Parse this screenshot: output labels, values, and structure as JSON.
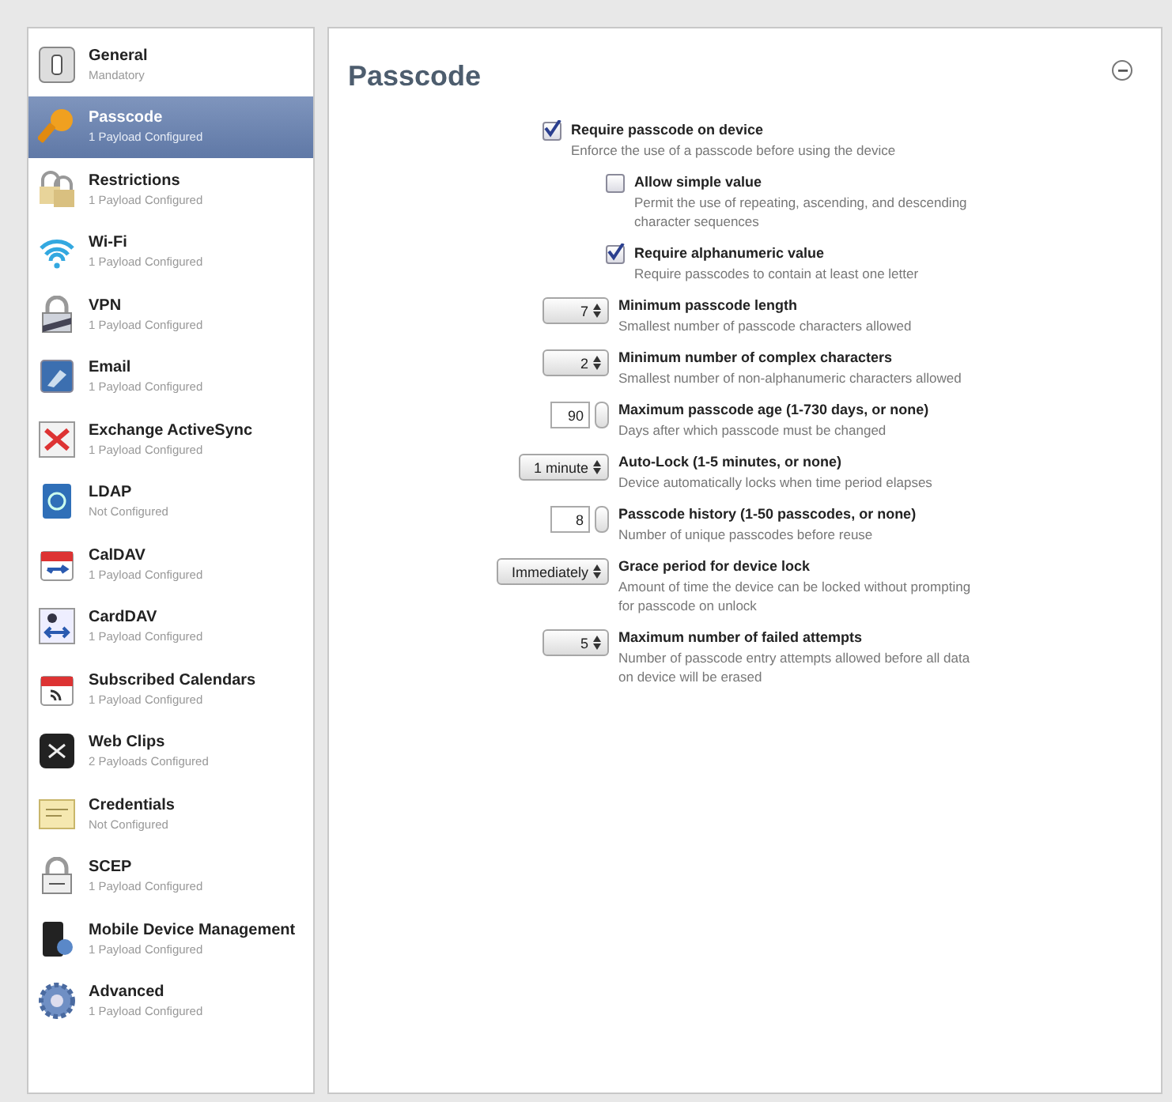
{
  "sidebar": {
    "items": [
      {
        "title": "General",
        "subtitle": "Mandatory",
        "selected": false
      },
      {
        "title": "Passcode",
        "subtitle": "1 Payload Configured",
        "selected": true
      },
      {
        "title": "Restrictions",
        "subtitle": "1 Payload Configured",
        "selected": false
      },
      {
        "title": "Wi-Fi",
        "subtitle": "1 Payload Configured",
        "selected": false
      },
      {
        "title": "VPN",
        "subtitle": "1 Payload Configured",
        "selected": false
      },
      {
        "title": "Email",
        "subtitle": "1 Payload Configured",
        "selected": false
      },
      {
        "title": "Exchange ActiveSync",
        "subtitle": "1 Payload Configured",
        "selected": false
      },
      {
        "title": "LDAP",
        "subtitle": "Not Configured",
        "selected": false
      },
      {
        "title": "CalDAV",
        "subtitle": "1 Payload Configured",
        "selected": false
      },
      {
        "title": "CardDAV",
        "subtitle": "1 Payload Configured",
        "selected": false
      },
      {
        "title": "Subscribed Calendars",
        "subtitle": "1 Payload Configured",
        "selected": false
      },
      {
        "title": "Web Clips",
        "subtitle": "2 Payloads Configured",
        "selected": false
      },
      {
        "title": "Credentials",
        "subtitle": "Not Configured",
        "selected": false
      },
      {
        "title": "SCEP",
        "subtitle": "1 Payload Configured",
        "selected": false
      },
      {
        "title": "Mobile Device Management",
        "subtitle": "1 Payload Configured",
        "selected": false
      },
      {
        "title": "Advanced",
        "subtitle": "1 Payload Configured",
        "selected": false
      }
    ]
  },
  "panel": {
    "title": "Passcode",
    "settings": [
      {
        "kind": "checkbox",
        "label": "Require passcode on device",
        "description": "Enforce the use of a passcode before using the device",
        "checked": true,
        "children": [
          {
            "kind": "checkbox",
            "label": "Allow simple value",
            "description": "Permit the use of repeating, ascending, and descending character sequences",
            "checked": false
          },
          {
            "kind": "checkbox",
            "label": "Require alphanumeric value",
            "description": "Require passcodes to contain at least one letter",
            "checked": true
          }
        ]
      },
      {
        "kind": "popup",
        "value": "7",
        "label": "Minimum passcode length",
        "description": "Smallest number of passcode characters allowed"
      },
      {
        "kind": "popup",
        "value": "2",
        "label": "Minimum number of complex characters",
        "description": "Smallest number of non-alphanumeric characters allowed"
      },
      {
        "kind": "stepper",
        "value": "90",
        "label": "Maximum passcode age (1-730 days, or none)",
        "description": "Days after which passcode must be changed"
      },
      {
        "kind": "popup",
        "value": "1 minute",
        "label": "Auto-Lock (1-5 minutes, or none)",
        "description": "Device automatically locks when time period elapses"
      },
      {
        "kind": "stepper",
        "value": "8",
        "label": "Passcode history (1-50 passcodes, or none)",
        "description": "Number of unique passcodes before reuse"
      },
      {
        "kind": "popup",
        "value": "Immediately",
        "label": "Grace period for device lock",
        "description": "Amount of time the device can be locked without prompting for passcode on unlock"
      },
      {
        "kind": "popup",
        "value": "5",
        "label": "Maximum number of failed attempts",
        "description": "Number of passcode entry attempts allowed before all data on device will be erased"
      }
    ]
  }
}
